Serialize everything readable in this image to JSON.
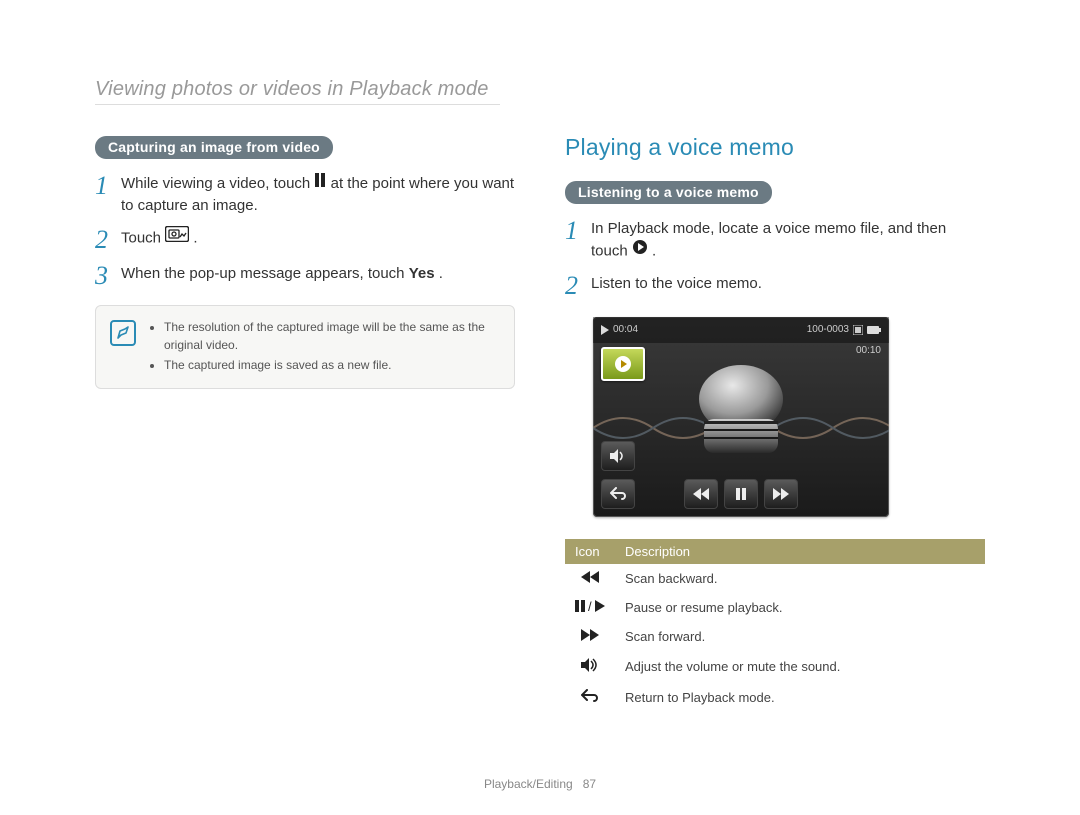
{
  "header": {
    "breadcrumb": "Viewing photos or videos in Playback mode"
  },
  "left": {
    "section_title": "Capturing an image from video",
    "steps": {
      "s1_pre": "While viewing a video, touch ",
      "s1_post": " at the point where you want to capture an image.",
      "s2_pre": "Touch ",
      "s2_post": ".",
      "s3_pre": "When the pop-up message appears, touch ",
      "s3_bold": "Yes",
      "s3_post": "."
    },
    "note": {
      "bullets": [
        "The resolution of the captured image will be the same as the original video.",
        "The captured image is saved as a new file."
      ]
    }
  },
  "right": {
    "heading": "Playing a voice memo",
    "section_title": "Listening to a voice memo",
    "steps": {
      "s1_pre": "In Playback mode, locate a voice memo file, and then touch ",
      "s1_post": ".",
      "s2": "Listen to the voice memo."
    },
    "memo_screen": {
      "elapsed": "00:04",
      "folder": "100-0003",
      "total": "00:10"
    },
    "icon_table": {
      "headers": {
        "icon": "Icon",
        "desc": "Description"
      },
      "rows": [
        {
          "name": "rewind-icon",
          "desc": "Scan backward."
        },
        {
          "name": "pause-play-icon",
          "desc": "Pause or resume playback."
        },
        {
          "name": "fastforward-icon",
          "desc": "Scan forward."
        },
        {
          "name": "volume-icon",
          "desc": "Adjust the volume or mute the sound."
        },
        {
          "name": "return-icon",
          "desc": "Return to Playback mode."
        }
      ]
    }
  },
  "footer": {
    "section": "Playback/Editing",
    "page": "87"
  }
}
